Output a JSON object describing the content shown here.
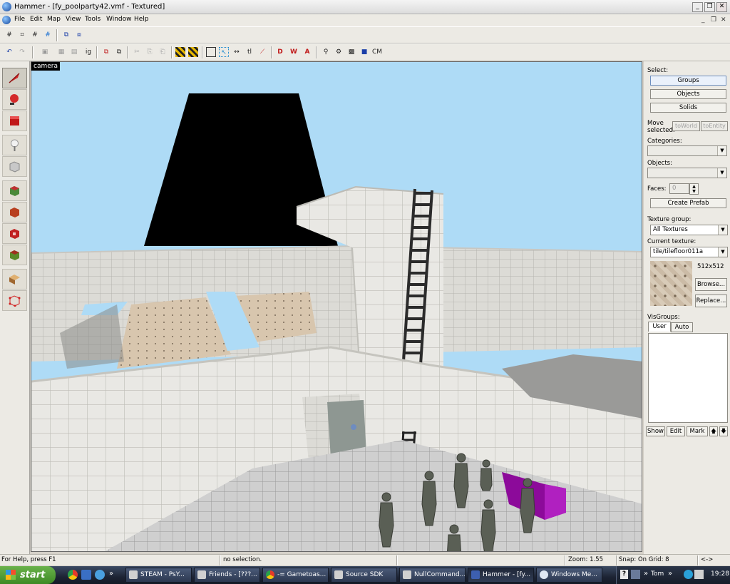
{
  "window": {
    "title": "Hammer - [fy_poolparty42.vmf - Textured]",
    "min": "_",
    "restore": "❐",
    "close": "✕"
  },
  "menubar": {
    "items": [
      "File",
      "Edit",
      "Map",
      "View",
      "Tools",
      "Window",
      "Help"
    ],
    "mdi": [
      "_",
      "❐",
      "✕"
    ]
  },
  "toolbar": {
    "cordon": "CM"
  },
  "tools": [
    {
      "name": "selection-tool",
      "icon": "arrow-icon",
      "color": "#d42a2a"
    },
    {
      "name": "magnify-tool",
      "icon": "magnify-icon",
      "color": "#d42a2a"
    },
    {
      "name": "camera-tool",
      "icon": "camera-icon",
      "color": "#c01818"
    },
    {
      "name": "entity-tool",
      "icon": "entity-icon",
      "color": "#f2f2f2"
    },
    {
      "name": "block-tool",
      "icon": "block-icon",
      "color": "#c8c8c8"
    },
    {
      "name": "texture-application-tool",
      "icon": "texture-icon",
      "color": "#4a8a3a"
    },
    {
      "name": "apply-current-texture-tool",
      "icon": "apply-texture-icon",
      "color": "#b84020"
    },
    {
      "name": "decal-tool",
      "icon": "decal-icon",
      "color": "#c02020"
    },
    {
      "name": "overlay-tool",
      "icon": "overlay-icon",
      "color": "#5a8a2a"
    },
    {
      "name": "clipping-tool",
      "icon": "clip-icon",
      "color": "#c89048"
    },
    {
      "name": "vertex-tool",
      "icon": "vertex-icon",
      "color": "#d02020"
    }
  ],
  "viewport": {
    "label": "camera"
  },
  "panel": {
    "select_label": "Select:",
    "groups": "Groups",
    "objects": "Objects",
    "solids": "Solids",
    "move_selected": "Move selected:",
    "to_world": "toWorld",
    "to_entity": "toEntity",
    "categories_label": "Categories:",
    "objects_label": "Objects:",
    "faces_label": "Faces:",
    "faces_value": "0",
    "create_prefab": "Create Prefab",
    "texture_group_label": "Texture group:",
    "texture_group": "All Textures",
    "current_texture_label": "Current texture:",
    "current_texture": "tile/tilefloor011a",
    "texture_size": "512x512",
    "browse": "Browse...",
    "replace": "Replace...",
    "visgroups_label": "VisGroups:",
    "tab_user": "User",
    "tab_auto": "Auto",
    "show": "Show",
    "edit": "Edit",
    "mark": "Mark",
    "up": "🡅",
    "down": "🡇"
  },
  "status": {
    "help": "For Help, press F1",
    "selection": "no selection.",
    "zoom": "Zoom: 1.55",
    "snap": "Snap: On Grid: 8",
    "coords": "<->"
  },
  "taskbar": {
    "start": "start",
    "more": "»",
    "tasks": [
      "STEAM - PsY...",
      "Friends - [???...",
      "-= Gametoas...",
      "Source SDK",
      "NullCommand...",
      "Hammer - [fy...",
      "Windows Me..."
    ],
    "tray_more": "»",
    "user": "Tom",
    "clock": "19:28",
    "help": "?"
  }
}
